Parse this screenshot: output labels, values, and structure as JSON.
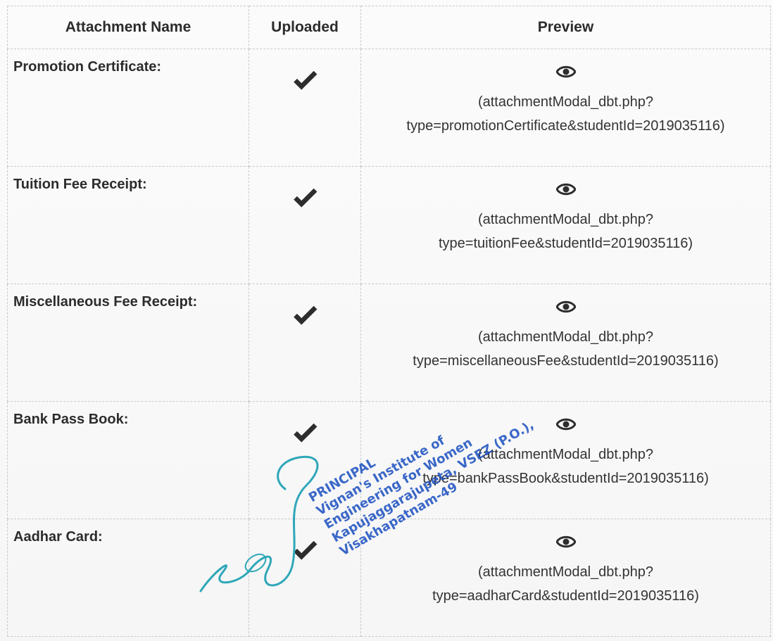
{
  "table": {
    "headers": {
      "name": "Attachment Name",
      "uploaded": "Uploaded",
      "preview": "Preview"
    },
    "rows": [
      {
        "name": "Promotion Certificate:",
        "uploaded_icon": "checkmark-icon",
        "preview_icon": "eye-icon",
        "link_line1": "(attachmentModal_dbt.php?",
        "link_line2": "type=promotionCertificate&studentId=2019035116)"
      },
      {
        "name": "Tuition Fee Receipt:",
        "uploaded_icon": "checkmark-icon",
        "preview_icon": "eye-icon",
        "link_line1": "(attachmentModal_dbt.php?",
        "link_line2": "type=tuitionFee&studentId=2019035116)"
      },
      {
        "name": "Miscellaneous Fee Receipt:",
        "uploaded_icon": "checkmark-icon",
        "preview_icon": "eye-icon",
        "link_line1": "(attachmentModal_dbt.php?",
        "link_line2": "type=miscellaneousFee&studentId=2019035116)"
      },
      {
        "name": "Bank Pass Book:",
        "uploaded_icon": "checkmark-icon",
        "preview_icon": "eye-icon",
        "link_line1": "(attachmentModal_dbt.php?",
        "link_line2": "type=bankPassBook&studentId=2019035116)"
      },
      {
        "name": "Aadhar Card:",
        "uploaded_icon": "checkmark-icon",
        "preview_icon": "eye-icon",
        "link_line1": "(attachmentModal_dbt.php?",
        "link_line2": "type=aadharCard&studentId=2019035116)"
      }
    ]
  },
  "stamp": {
    "lines": [
      "PRINCIPAL",
      "Vignan's Institute of",
      "Engineering for Women",
      "Kapujaggarajupeta, VSEZ (P.O.),",
      "Visakhapatnam-49"
    ],
    "color": "#1a4fc0"
  },
  "colors": {
    "text": "#2a2a2a",
    "border": "#c9c9c9",
    "signature": "#2ea7b8"
  }
}
